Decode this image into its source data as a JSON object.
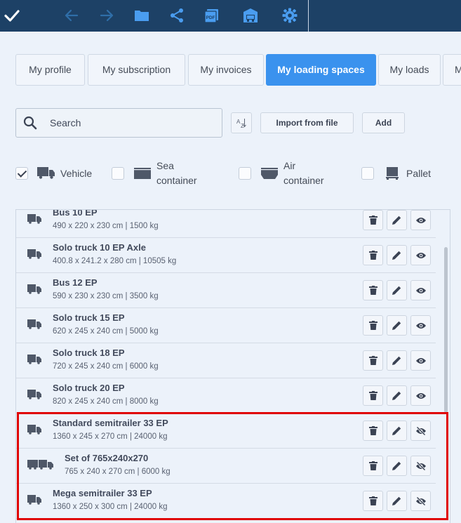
{
  "toolbar": {
    "icons": [
      "check-icon",
      "arrow-left-icon",
      "arrow-right-icon",
      "folder-icon",
      "share-icon",
      "pdf-icon",
      "garage-icon",
      "gear-icon"
    ]
  },
  "tabs": [
    {
      "label": "My profile"
    },
    {
      "label": "My subscription"
    },
    {
      "label": "My invoices"
    },
    {
      "label": "My loading spaces",
      "active": true
    },
    {
      "label": "My loads"
    },
    {
      "label": "M"
    }
  ],
  "search": {
    "placeholder": "Search",
    "value": ""
  },
  "buttons": {
    "sort_label": "AZ",
    "import_label": "Import from file",
    "add_label": "Add"
  },
  "filters": [
    {
      "label": "Vehicle",
      "checked": true,
      "icon": "truck-icon"
    },
    {
      "label_line1": "Sea",
      "label_line2": "container",
      "checked": false,
      "icon": "sea-container-icon"
    },
    {
      "label_line1": "Air",
      "label_line2": "container",
      "checked": false,
      "icon": "air-container-icon"
    },
    {
      "label": "Pallet",
      "checked": false,
      "icon": "pallet-icon"
    }
  ],
  "items": [
    {
      "name": "Bus 10 EP",
      "dims": "490 x 220 x 230 cm | 1500 kg",
      "visible": true
    },
    {
      "name": "Solo truck 10 EP Axle",
      "dims": "400.8 x 241.2 x 280 cm | 10505 kg",
      "visible": true
    },
    {
      "name": "Bus 12 EP",
      "dims": "590 x 230 x 230 cm | 3500 kg",
      "visible": true
    },
    {
      "name": "Solo truck 15 EP",
      "dims": "620 x 245 x 240 cm | 5000 kg",
      "visible": true
    },
    {
      "name": "Solo truck 18 EP",
      "dims": "720 x 245 x 240 cm | 6000 kg",
      "visible": true
    },
    {
      "name": "Solo truck 20 EP",
      "dims": "820 x 245 x 240 cm | 8000 kg",
      "visible": true
    },
    {
      "name": "Standard semitrailer 33 EP",
      "dims": "1360 x 245 x 270 cm | 24000 kg",
      "visible": false
    },
    {
      "name": "Set of 765x240x270",
      "dims": "765 x 240 x 270 cm | 6000 kg",
      "visible": false,
      "set": true
    },
    {
      "name": "Mega semitrailer 33 EP",
      "dims": "1360 x 250 x 300 cm | 24000 kg",
      "visible": false
    }
  ],
  "colors": {
    "toolbar": "#1d4166",
    "toolbar_icon": "#4a9df0",
    "accent": "#3a92ee",
    "highlight": "#e00000"
  }
}
